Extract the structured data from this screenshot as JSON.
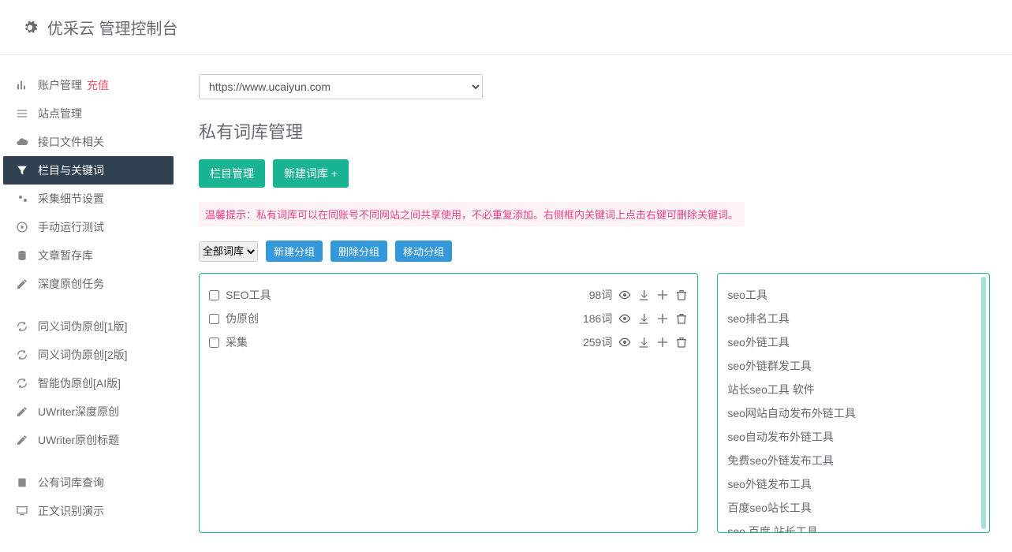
{
  "header": {
    "title": "优采云 管理控制台"
  },
  "site_select": {
    "selected": "https://www.ucaiyun.com"
  },
  "page": {
    "title": "私有词库管理",
    "btn_category": "栏目管理",
    "btn_new_lib": "新建词库 +",
    "tip": "温馨提示：私有词库可以在同账号不同网站之间共享使用，不必重复添加。右侧框内关键词上点击右键可删除关键词。",
    "group_select": "全部词库",
    "btn_new_group": "新建分组",
    "btn_del_group": "删除分组",
    "btn_move_group": "移动分组",
    "count_suffix": "词"
  },
  "sidebar": {
    "items": [
      {
        "icon": "bar-chart",
        "label": "账户管理",
        "extra": "充值"
      },
      {
        "icon": "list",
        "label": "站点管理"
      },
      {
        "icon": "cloud",
        "label": "接口文件相关"
      },
      {
        "icon": "filter",
        "label": "栏目与关键词",
        "active": true
      },
      {
        "icon": "gears",
        "label": "采集细节设置"
      },
      {
        "icon": "play",
        "label": "手动运行测试"
      },
      {
        "icon": "db",
        "label": "文章暂存库"
      },
      {
        "icon": "edit",
        "label": "深度原创任务"
      }
    ],
    "group2": [
      {
        "icon": "refresh",
        "label": "同义词伪原创[1版]"
      },
      {
        "icon": "refresh",
        "label": "同义词伪原创[2版]"
      },
      {
        "icon": "refresh",
        "label": "智能伪原创[AI版]"
      },
      {
        "icon": "edit",
        "label": "UWriter深度原创"
      },
      {
        "icon": "edit",
        "label": "UWriter原创标题"
      }
    ],
    "group3": [
      {
        "icon": "book",
        "label": "公有词库查询"
      },
      {
        "icon": "monitor",
        "label": "正文识别演示"
      }
    ]
  },
  "libs": [
    {
      "name": "SEO工具",
      "count": 98
    },
    {
      "name": "伪原创",
      "count": 186
    },
    {
      "name": "采集",
      "count": 259
    }
  ],
  "keywords": [
    "seo工具",
    "seo排名工具",
    "seo外链工具",
    "seo外链群发工具",
    "站长seo工具 软件",
    "seo网站自动发布外链工具",
    "seo自动发布外链工具",
    "免费seo外链发布工具",
    "seo外链发布工具",
    "百度seo站长工具",
    "seo 百度 站长工具"
  ]
}
